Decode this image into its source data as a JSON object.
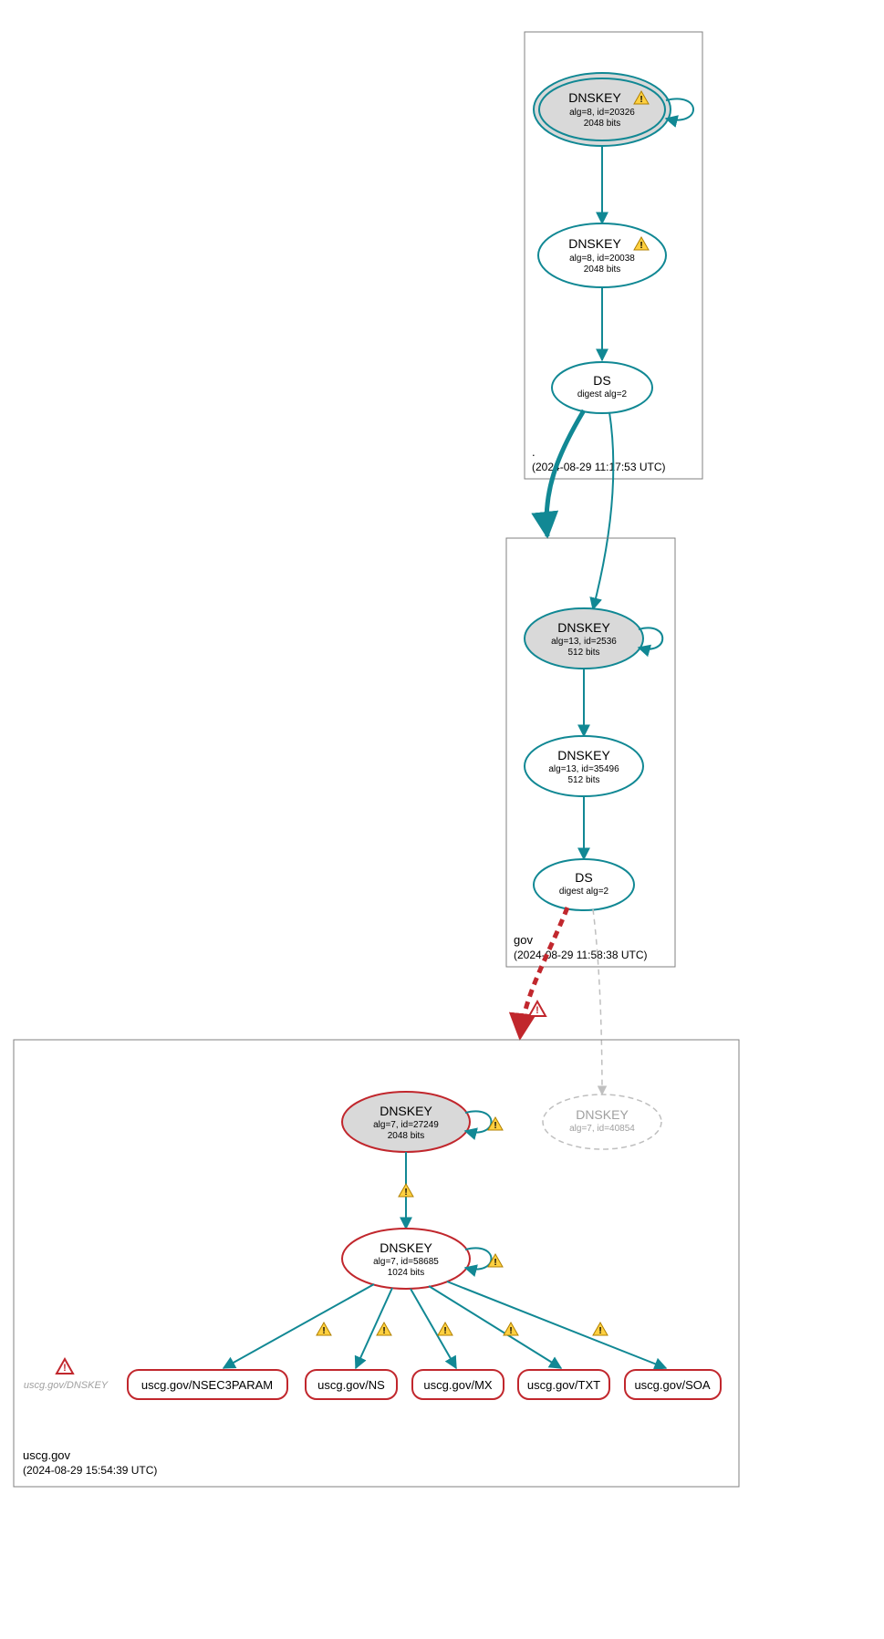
{
  "zones": {
    "root": {
      "label": ".",
      "timestamp": "(2024-08-29 11:17:53 UTC)"
    },
    "gov": {
      "label": "gov",
      "timestamp": "(2024-08-29 11:58:38 UTC)"
    },
    "uscg": {
      "label": "uscg.gov",
      "timestamp": "(2024-08-29 15:54:39 UTC)"
    }
  },
  "nodes": {
    "root_ksk": {
      "title": "DNSKEY",
      "line1": "alg=8, id=20326",
      "line2": "2048 bits"
    },
    "root_zsk": {
      "title": "DNSKEY",
      "line1": "alg=8, id=20038",
      "line2": "2048 bits"
    },
    "root_ds": {
      "title": "DS",
      "line1": "digest alg=2"
    },
    "gov_ksk": {
      "title": "DNSKEY",
      "line1": "alg=13, id=2536",
      "line2": "512 bits"
    },
    "gov_zsk": {
      "title": "DNSKEY",
      "line1": "alg=13, id=35496",
      "line2": "512 bits"
    },
    "gov_ds": {
      "title": "DS",
      "line1": "digest alg=2"
    },
    "uscg_ksk": {
      "title": "DNSKEY",
      "line1": "alg=7, id=27249",
      "line2": "2048 bits"
    },
    "uscg_zsk": {
      "title": "DNSKEY",
      "line1": "alg=7, id=58685",
      "line2": "1024 bits"
    },
    "uscg_ghost": {
      "title": "DNSKEY",
      "line1": "alg=7, id=40854"
    }
  },
  "rr": {
    "nsec3param": "uscg.gov/NSEC3PARAM",
    "ns": "uscg.gov/NS",
    "mx": "uscg.gov/MX",
    "txt": "uscg.gov/TXT",
    "soa": "uscg.gov/SOA"
  },
  "ghost_label": "uscg.gov/DNSKEY",
  "colors": {
    "teal": "#118894",
    "red": "#c1272d",
    "grayFill": "#d9d9d9",
    "ghost": "#bfbfbf"
  }
}
